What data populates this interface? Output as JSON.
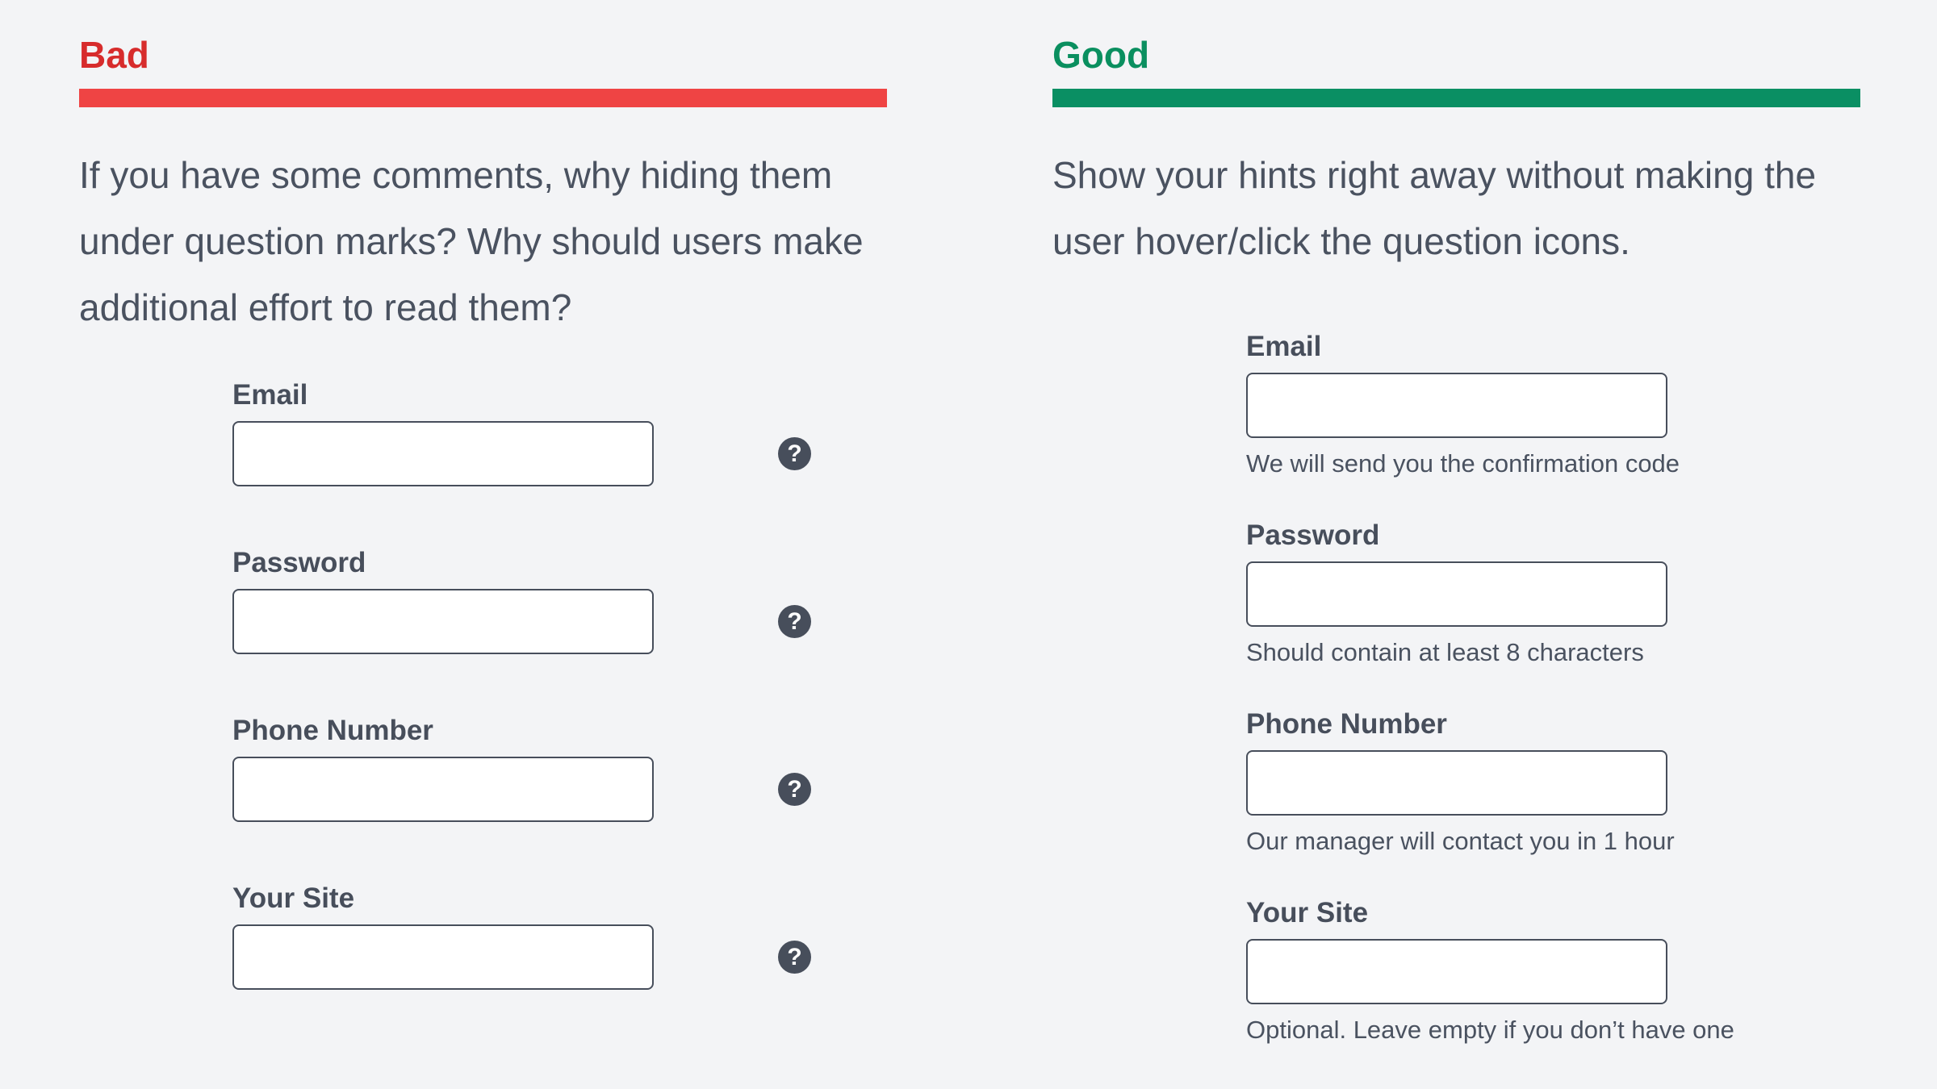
{
  "bad": {
    "heading": "Bad",
    "description_lines": [
      "If you have some comments, why hiding them",
      "under question marks? Why should users make",
      "additional effort to read them?"
    ],
    "help_glyph": "?",
    "fields": [
      {
        "label": "Email",
        "value": "",
        "icon": "question-circle-icon"
      },
      {
        "label": "Password",
        "value": "",
        "icon": "question-circle-icon"
      },
      {
        "label": "Phone Number",
        "value": "",
        "icon": "question-circle-icon"
      },
      {
        "label": "Your Site",
        "value": "",
        "icon": "question-circle-icon"
      }
    ]
  },
  "good": {
    "heading": "Good",
    "description_lines": [
      "Show your hints right away without making the",
      "user hover/click the question icons."
    ],
    "fields": [
      {
        "label": "Email",
        "value": "",
        "hint": "We will send you the confirmation code"
      },
      {
        "label": "Password",
        "value": "",
        "hint": "Should contain at least 8 characters"
      },
      {
        "label": "Phone Number",
        "value": "",
        "hint": "Our manager will contact you in 1 hour"
      },
      {
        "label": "Your Site",
        "value": "",
        "hint": "Optional. Leave empty if you don’t have one"
      }
    ]
  },
  "colors": {
    "background": "#f3f4f6",
    "text": "#474e5b",
    "bad_accent": "#ef4444",
    "bad_heading": "#d72c2c",
    "good_accent": "#0a8f63"
  }
}
